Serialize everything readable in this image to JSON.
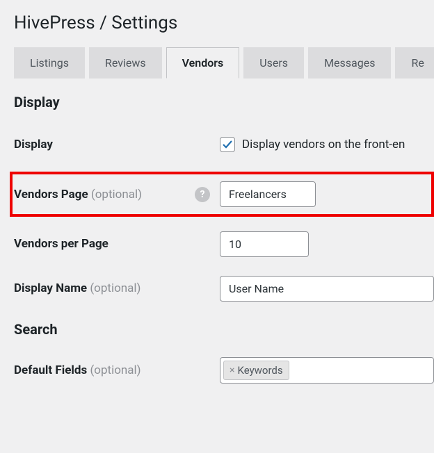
{
  "page_title": "HivePress / Settings",
  "tabs": {
    "listings": "Listings",
    "reviews": "Reviews",
    "vendors": "Vendors",
    "users": "Users",
    "messages": "Messages",
    "requests": "Re"
  },
  "sections": {
    "display_heading": "Display",
    "search_heading": "Search"
  },
  "fields": {
    "display_cb": {
      "label": "Display",
      "desc": "Display vendors on the front-en"
    },
    "vendors_page": {
      "label": "Vendors Page ",
      "optional": "(optional)",
      "value": "Freelancers"
    },
    "vendors_per_page": {
      "label": "Vendors per Page",
      "value": "10"
    },
    "display_name": {
      "label": "Display Name ",
      "optional": "(optional)",
      "value": "User Name"
    },
    "default_fields": {
      "label": "Default Fields ",
      "optional": "(optional)",
      "tag": "Keywords"
    }
  }
}
